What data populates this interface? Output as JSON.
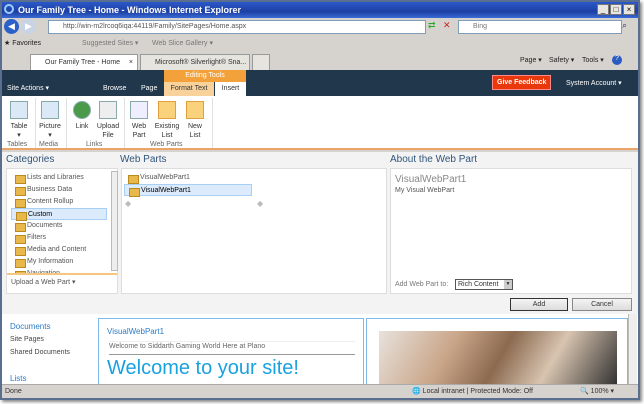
{
  "window": {
    "title": "Our Family Tree - Home - Windows Internet Explorer"
  },
  "address": {
    "url": "http://win-m2lrcoq6iqa:44119/Family/SitePages/Home.aspx",
    "search_placeholder": "Bing"
  },
  "favorites": {
    "label": "Favorites",
    "items": [
      "Suggested Sites ▾",
      "Web Slice Gallery ▾"
    ]
  },
  "tabs": [
    {
      "label": "Our Family Tree - Home"
    },
    {
      "label": "Microsoft® Silverlight® Sna..."
    }
  ],
  "commandbar": {
    "page": "Page ▾",
    "safety": "Safety ▾",
    "tools": "Tools ▾"
  },
  "sharepoint": {
    "site_actions": "Site Actions ▾",
    "browse": "Browse",
    "page": "Page",
    "editing_tools": "Editing Tools",
    "format_text": "Format Text",
    "insert": "Insert",
    "feedback": "Give Feedback",
    "account": "System Account ▾"
  },
  "ribbon": {
    "buttons": [
      "Table",
      "Picture",
      "Link",
      "Upload File",
      "Web Part",
      "Existing List",
      "New List"
    ],
    "groups": [
      "Tables",
      "Media",
      "Links",
      "Web Parts"
    ]
  },
  "adder": {
    "categories_title": "Categories",
    "webparts_title": "Web Parts",
    "about_title": "About the Web Part",
    "categories": [
      "Lists and Libraries",
      "Business Data",
      "Content Rollup",
      "Custom",
      "Documents",
      "Filters",
      "Media and Content",
      "My Information",
      "Navigation"
    ],
    "upload": "Upload a Web Part ▾",
    "webparts": [
      "VisualWebPart1",
      "VisualWebPart1"
    ],
    "about_name": "VisualWebPart1",
    "about_desc": "My Visual WebPart",
    "add_to_label": "Add Web Part to:",
    "add_to_value": "Rich Content",
    "add": "Add",
    "cancel": "Cancel"
  },
  "page": {
    "quick_launch": {
      "documents": "Documents",
      "site_pages": "Site Pages",
      "shared_documents": "Shared Documents",
      "lists": "Lists"
    },
    "webpart_title": "VisualWebPart1",
    "webpart_text": "Welcome to Siddarth Gaming World Here at Plano",
    "welcome": "Welcome to your site!"
  },
  "statusbar": {
    "text": "Done",
    "zone": "Local intranet | Protected Mode: Off",
    "zoom": "100%"
  }
}
